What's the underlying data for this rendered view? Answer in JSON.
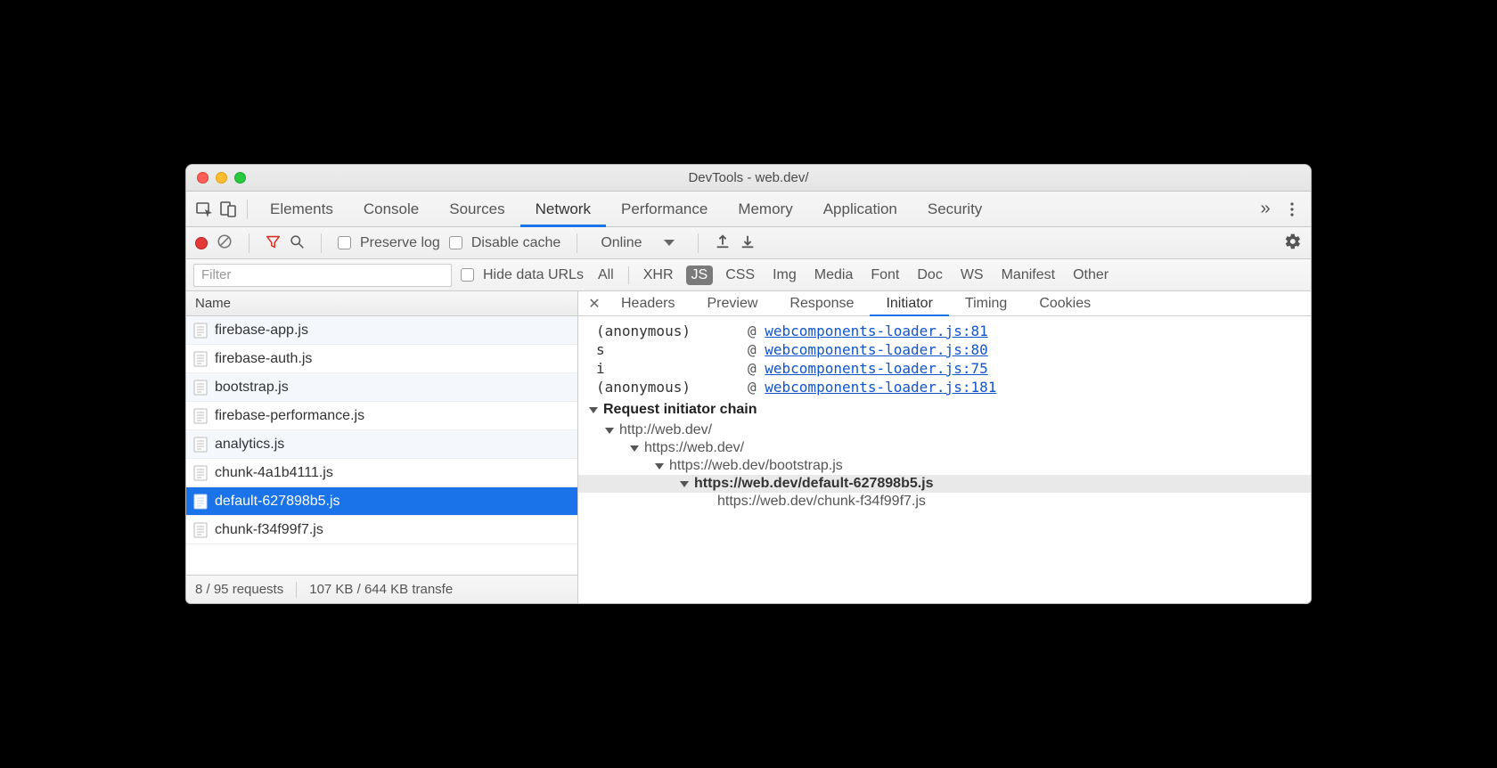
{
  "window_title": "DevTools - web.dev/",
  "main_tabs": [
    "Elements",
    "Console",
    "Sources",
    "Network",
    "Performance",
    "Memory",
    "Application",
    "Security"
  ],
  "main_tab_active": "Network",
  "toolbar": {
    "preserve_log": "Preserve log",
    "disable_cache": "Disable cache",
    "throttling": "Online"
  },
  "filter": {
    "placeholder": "Filter",
    "hide_data_urls": "Hide data URLs",
    "types": [
      "All",
      "XHR",
      "JS",
      "CSS",
      "Img",
      "Media",
      "Font",
      "Doc",
      "WS",
      "Manifest",
      "Other"
    ],
    "type_selected": "JS"
  },
  "requests": {
    "column": "Name",
    "rows": [
      {
        "name": "firebase-app.js",
        "sel": false
      },
      {
        "name": "firebase-auth.js",
        "sel": false
      },
      {
        "name": "bootstrap.js",
        "sel": false
      },
      {
        "name": "firebase-performance.js",
        "sel": false
      },
      {
        "name": "analytics.js",
        "sel": false
      },
      {
        "name": "chunk-4a1b4111.js",
        "sel": false
      },
      {
        "name": "default-627898b5.js",
        "sel": true
      },
      {
        "name": "chunk-f34f99f7.js",
        "sel": false
      }
    ],
    "status_requests": "8 / 95 requests",
    "status_transfer": "107 KB / 644 KB transfe"
  },
  "detail_tabs": [
    "Headers",
    "Preview",
    "Response",
    "Initiator",
    "Timing",
    "Cookies"
  ],
  "detail_tab_active": "Initiator",
  "stack": [
    {
      "fn": "(anonymous)",
      "link": "webcomponents-loader.js:81"
    },
    {
      "fn": "s",
      "link": "webcomponents-loader.js:80"
    },
    {
      "fn": "i",
      "link": "webcomponents-loader.js:75"
    },
    {
      "fn": "(anonymous)",
      "link": "webcomponents-loader.js:181"
    }
  ],
  "chain_header": "Request initiator chain",
  "chain": [
    {
      "depth": 0,
      "text": "http://web.dev/",
      "bold": false,
      "arrow": true
    },
    {
      "depth": 1,
      "text": "https://web.dev/",
      "bold": false,
      "arrow": true
    },
    {
      "depth": 2,
      "text": "https://web.dev/bootstrap.js",
      "bold": false,
      "arrow": true
    },
    {
      "depth": 3,
      "text": "https://web.dev/default-627898b5.js",
      "bold": true,
      "arrow": true,
      "hl": true
    },
    {
      "depth": 4,
      "text": "https://web.dev/chunk-f34f99f7.js",
      "bold": false,
      "arrow": false
    }
  ]
}
